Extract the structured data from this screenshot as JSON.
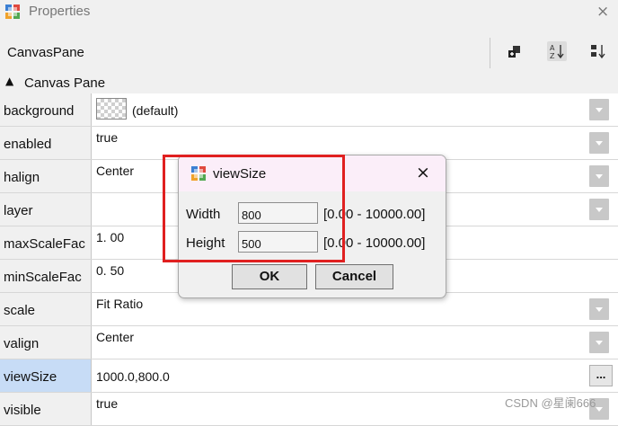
{
  "window": {
    "title": "Properties",
    "close_glyph": "×",
    "icon": "properties-app-icon"
  },
  "header": {
    "object_name": "CanvasPane",
    "toolbar": [
      {
        "name": "show-categories-icon",
        "active": false
      },
      {
        "name": "sort-alphabetical-icon",
        "active": true
      },
      {
        "name": "show-description-icon",
        "active": false
      }
    ]
  },
  "category": {
    "label": "Canvas Pane",
    "collapse_glyph": "▲"
  },
  "properties": [
    {
      "name": "background",
      "value": "(default)",
      "editor": "dropdown",
      "swatch": "transparent"
    },
    {
      "name": "enabled",
      "value": "true",
      "editor": "dropdown"
    },
    {
      "name": "halign",
      "value": "Center",
      "editor": "dropdown"
    },
    {
      "name": "layer",
      "value": "",
      "editor": "dropdown"
    },
    {
      "name": "maxScaleFac",
      "value": "1. 00",
      "editor": "none"
    },
    {
      "name": "minScaleFac",
      "value": "0. 50",
      "editor": "none"
    },
    {
      "name": "scale",
      "value": "Fit Ratio",
      "editor": "dropdown"
    },
    {
      "name": "valign",
      "value": "Center",
      "editor": "dropdown"
    },
    {
      "name": "viewSize",
      "value": "1000.0,800.0",
      "editor": "ellipsis",
      "selected": true,
      "ellipsis_label": "..."
    },
    {
      "name": "visible",
      "value": "true",
      "editor": "dropdown"
    }
  ],
  "dialog": {
    "title": "viewSize",
    "close_glyph": "×",
    "width_label": "Width",
    "width_value": "800",
    "width_range": "[0.00 - 10000.00]",
    "height_label": "Height",
    "height_value": "500",
    "height_range": "[0.00 - 10000.00]",
    "ok_label": "OK",
    "cancel_label": "Cancel"
  },
  "colors": {
    "selection": "#c7dcf6",
    "annotation": "#e02020",
    "dialog_title_bg": "#fbeef9"
  },
  "watermark": "CSDN @星阑666"
}
